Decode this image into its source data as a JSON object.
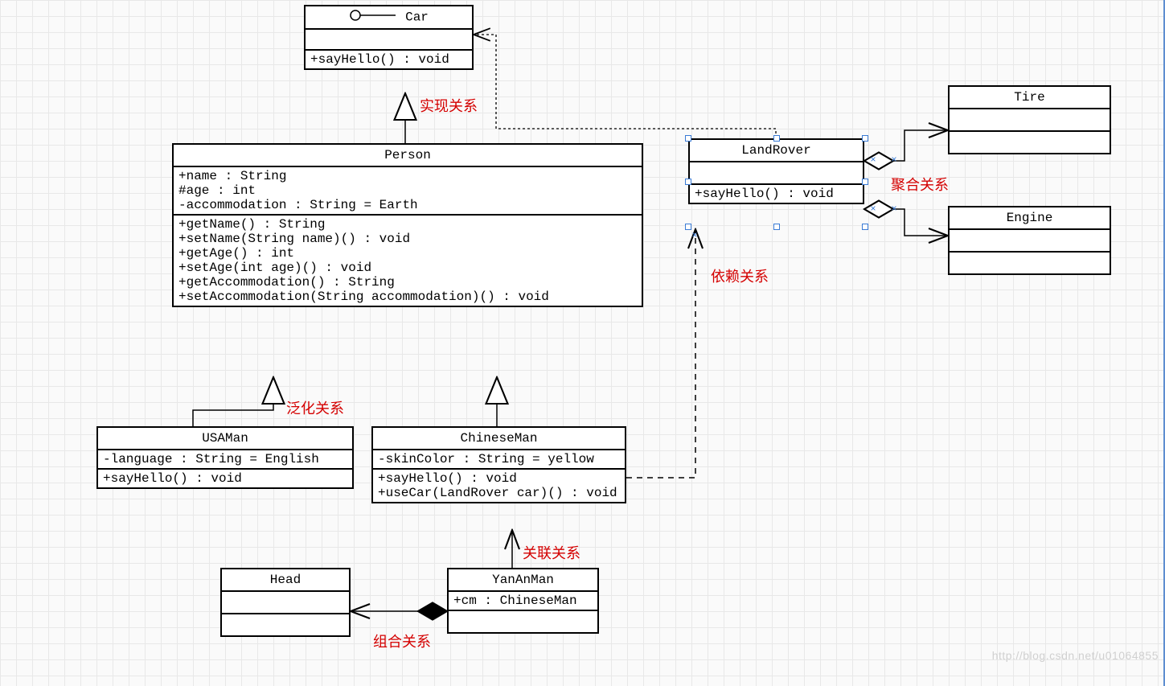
{
  "classes": {
    "Car": {
      "name": "Car",
      "stereotype": "interface",
      "operations": [
        "+sayHello() : void"
      ]
    },
    "Person": {
      "name": "Person",
      "attributes": [
        "+name : String",
        "#age : int",
        "-accommodation : String = Earth"
      ],
      "operations": [
        "+getName() : String",
        "+setName(String name)() : void",
        "+getAge() : int",
        "+setAge(int age)() : void",
        "+getAccommodation() : String",
        "+setAccommodation(String accommodation)() : void"
      ]
    },
    "LandRover": {
      "name": "LandRover",
      "operations": [
        "+sayHello() : void"
      ]
    },
    "Tire": {
      "name": "Tire"
    },
    "Engine": {
      "name": "Engine"
    },
    "USAMan": {
      "name": "USAMan",
      "attributes": [
        "-language : String = English"
      ],
      "operations": [
        "+sayHello() : void"
      ]
    },
    "ChineseMan": {
      "name": "ChineseMan",
      "attributes": [
        "-skinColor : String = yellow"
      ],
      "operations": [
        "+sayHello() : void",
        "+useCar(LandRover car)() : void"
      ]
    },
    "YanAnMan": {
      "name": "YanAnMan",
      "attributes": [
        "+cm : ChineseMan"
      ]
    },
    "Head": {
      "name": "Head"
    }
  },
  "labels": {
    "realization": "实现关系",
    "generalization": "泛化关系",
    "association": "关联关系",
    "composition": "组合关系",
    "dependency": "依赖关系",
    "aggregation": "聚合关系"
  },
  "watermark": "http://blog.csdn.net/u01064855"
}
